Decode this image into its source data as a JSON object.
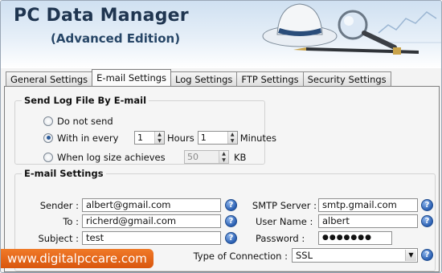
{
  "header": {
    "title": "PC Data Manager",
    "edition": "(Advanced Edition)",
    "art_icons": [
      "hat-icon",
      "magnifier-icon",
      "pen-icon"
    ]
  },
  "tabs": [
    {
      "label": "General Settings",
      "active": false
    },
    {
      "label": "E-mail Settings",
      "active": true
    },
    {
      "label": "Log Settings",
      "active": false
    },
    {
      "label": "FTP Settings",
      "active": false
    },
    {
      "label": "Security Settings",
      "active": false
    }
  ],
  "send_log": {
    "title": "Send Log File By E-mail",
    "do_not_send": "Do not send",
    "within_every": "With in every",
    "hours_value": "1",
    "hours_label": "Hours",
    "minutes_value": "1",
    "minutes_label": "Minutes",
    "log_size": "When log size achieves",
    "log_size_value": "50",
    "log_size_unit": "KB",
    "selected_option": "within_every"
  },
  "email": {
    "title": "E-mail Settings",
    "sender_label": "Sender :",
    "sender_value": "albert@gmail.com",
    "to_label": "To :",
    "to_value": "richerd@gmail.com",
    "subject_label": "Subject :",
    "subject_value": "test",
    "smtp_label": "SMTP Server :",
    "smtp_value": "smtp.gmail.com",
    "user_label": "User Name :",
    "user_value": "albert",
    "password_label": "Password :",
    "password_value": "●●●●●●●",
    "connection_label": "Type of Connection :",
    "connection_value": "SSL",
    "help_symbol": "?"
  },
  "watermark": "www.digitalpccare.com",
  "colors": {
    "accent": "#2a5fb2",
    "title": "#1f3550",
    "watermark": "#e8661a"
  }
}
